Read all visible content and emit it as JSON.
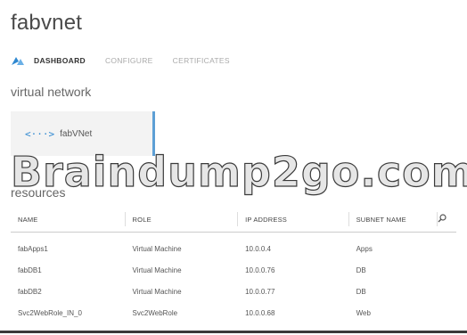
{
  "header": {
    "title": "fabvnet"
  },
  "tabs": [
    {
      "label": "DASHBOARD",
      "active": true
    },
    {
      "label": "CONFIGURE",
      "active": false
    },
    {
      "label": "CERTIFICATES",
      "active": false
    }
  ],
  "network_section": {
    "heading": "virtual network",
    "tile": {
      "icon": "<···>",
      "label": "fabVNet"
    }
  },
  "watermark": "Braindump2go.com",
  "resources": {
    "heading": "resources",
    "columns": [
      "NAME",
      "ROLE",
      "IP ADDRESS",
      "SUBNET NAME"
    ],
    "rows": [
      [
        "fabApps1",
        "Virtual Machine",
        "10.0.0.4",
        "Apps"
      ],
      [
        "fabDB1",
        "Virtual Machine",
        "10.0.0.76",
        "DB"
      ],
      [
        "fabDB2",
        "Virtual Machine",
        "10.0.0.77",
        "DB"
      ],
      [
        "Svc2WebRole_IN_0",
        "Svc2WebRole",
        "10.0.0.68",
        "Web"
      ]
    ]
  },
  "colors": {
    "accent": "#2f88d0",
    "tile_border": "#5d9fd5"
  }
}
